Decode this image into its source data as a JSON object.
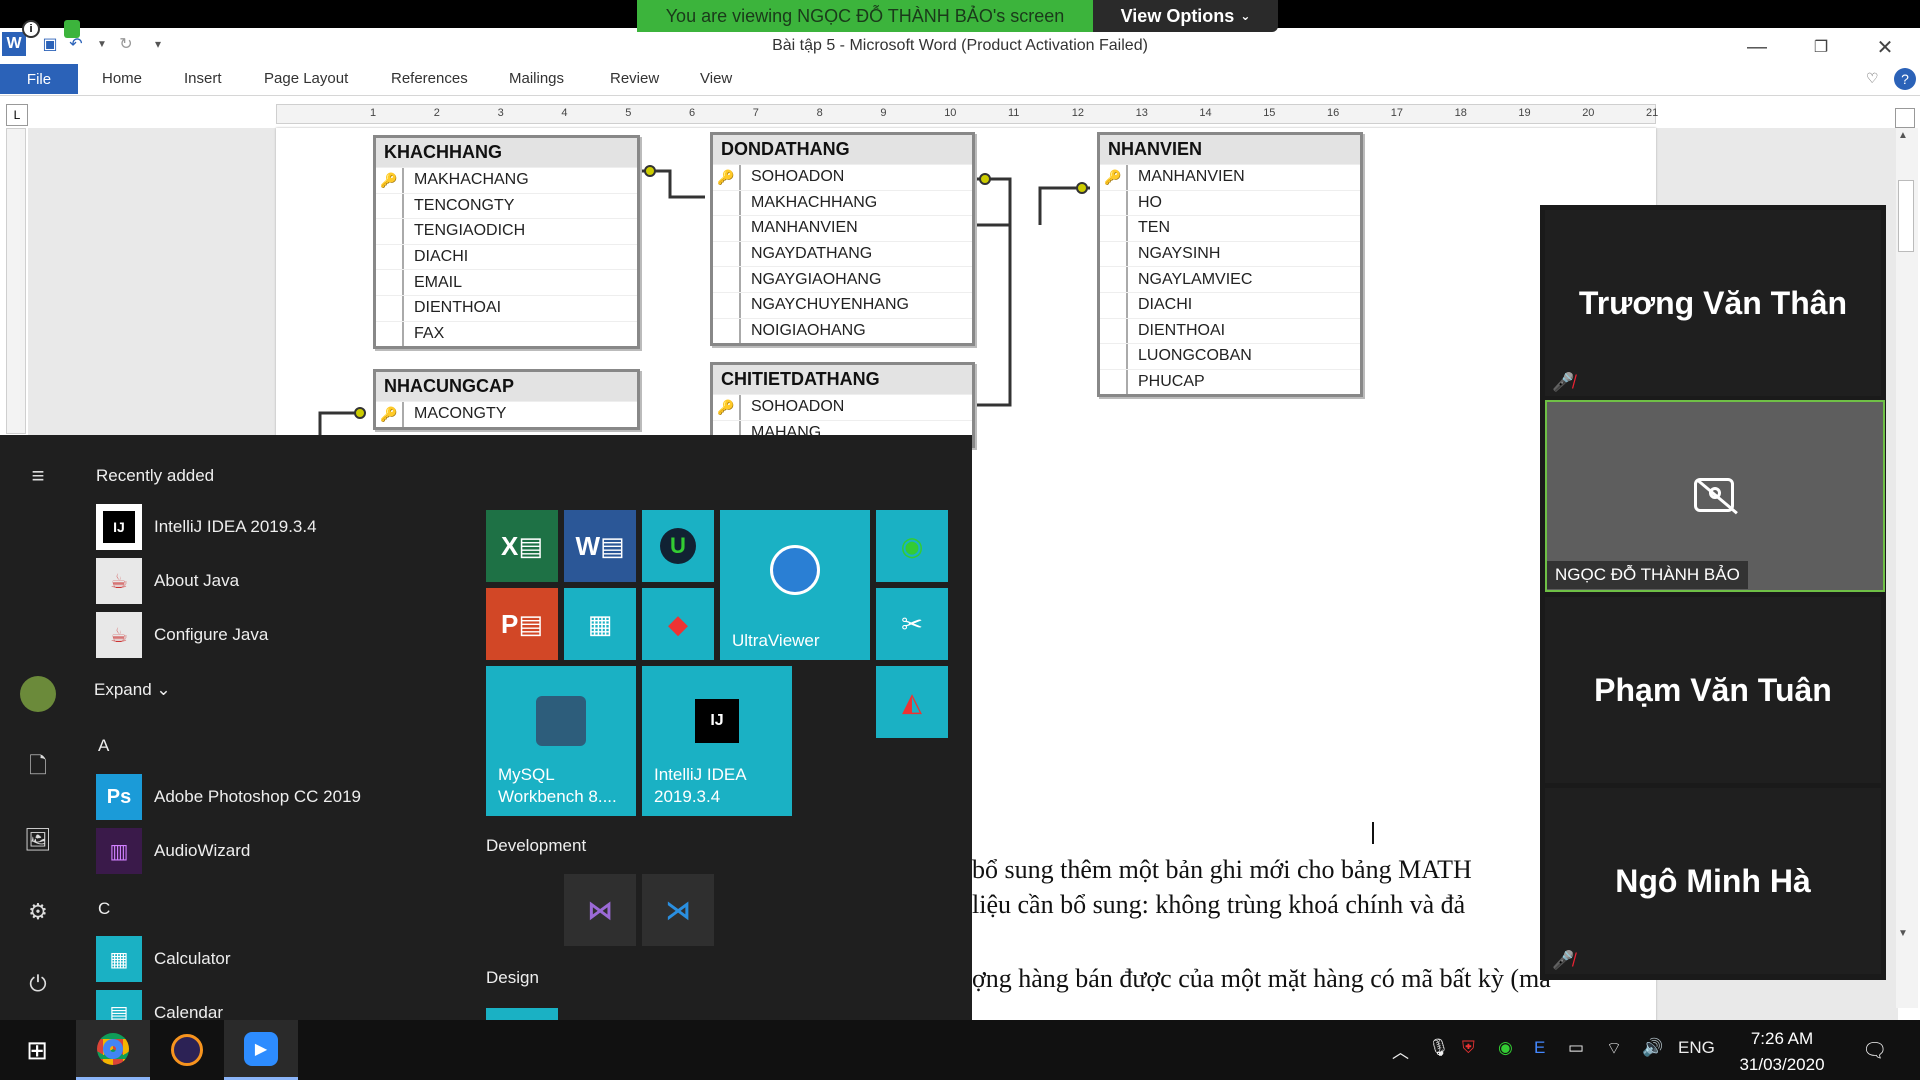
{
  "zoom": {
    "banner": "You are viewing NGỌC ĐỖ THÀNH BẢO's screen",
    "view_options": "View Options",
    "participants": [
      {
        "name": "Trương Văn Thân"
      },
      {
        "name": "NGỌC ĐỖ THÀNH BẢO"
      },
      {
        "name": "Phạm Văn Tuân"
      },
      {
        "name": "Ngô Minh Hà"
      }
    ]
  },
  "word": {
    "title": "Bài tập 5  -  Microsoft Word (Product Activation Failed)",
    "tabs": [
      "File",
      "Home",
      "Insert",
      "Page Layout",
      "References",
      "Mailings",
      "Review",
      "View"
    ],
    "ruler_numbers": [
      "1",
      "2",
      "3",
      "4",
      "5",
      "6",
      "7",
      "8",
      "9",
      "10",
      "11",
      "12",
      "13",
      "14",
      "15",
      "16",
      "17",
      "18",
      "19",
      "20",
      "21"
    ],
    "tables": {
      "khachhang": {
        "title": "KHACHHANG",
        "fields": [
          "MAKHACHANG",
          "TENCONGTY",
          "TENGIAODICH",
          "DIACHI",
          "EMAIL",
          "DIENTHOAI",
          "FAX"
        ]
      },
      "dondathang": {
        "title": "DONDATHANG",
        "fields": [
          "SOHOADON",
          "MAKHACHHANG",
          "MANHANVIEN",
          "NGAYDATHANG",
          "NGAYGIAOHANG",
          "NGAYCHUYENHANG",
          "NOIGIAOHANG"
        ]
      },
      "nhanvien": {
        "title": "NHANVIEN",
        "fields": [
          "MANHANVIEN",
          "HO",
          "TEN",
          "NGAYSINH",
          "NGAYLAMVIEC",
          "DIACHI",
          "DIENTHOAI",
          "LUONGCOBAN",
          "PHUCAP"
        ]
      },
      "nhacungcap": {
        "title": "NHACUNGCAP",
        "fields": [
          "MACONGTY"
        ]
      },
      "chitietdathang": {
        "title": "CHITIETDATHANG",
        "fields": [
          "SOHOADON",
          "MAHANG"
        ]
      }
    },
    "body_lines": [
      "bổ sung thêm một bản ghi mới cho bảng MATH",
      "liệu cần bổ sung: không trùng khoá chính và đả",
      "ợng hàng bán được của một mặt hàng có mã bất kỳ (mã"
    ]
  },
  "start_menu": {
    "recently_added": "Recently added",
    "recent": [
      {
        "label": "IntelliJ IDEA 2019.3.4",
        "icon": "IJ"
      },
      {
        "label": "About Java",
        "icon": "☕"
      },
      {
        "label": "Configure Java",
        "icon": "☕"
      }
    ],
    "expand": "Expand",
    "letter_a": "A",
    "a_apps": [
      {
        "label": "Adobe Photoshop CC 2019",
        "icon": "Ps"
      },
      {
        "label": "AudioWizard",
        "icon": "▥"
      }
    ],
    "letter_c": "C",
    "c_apps": [
      {
        "label": "Calculator",
        "icon": "▦"
      },
      {
        "label": "Calendar",
        "icon": "▤"
      }
    ],
    "tiles": {
      "ultraviewer": "UltraViewer",
      "mysql": "MySQL Workbench 8....",
      "intellij": "IntelliJ IDEA 2019.3.4"
    },
    "development": "Development",
    "design": "Design"
  },
  "taskbar": {
    "lang": "ENG",
    "time": "7:26 AM",
    "date": "31/03/2020"
  },
  "colors": {
    "zoom_green": "#3cb43c",
    "word_blue": "#2b62b8",
    "tile_teal": "#1ab1c4"
  }
}
